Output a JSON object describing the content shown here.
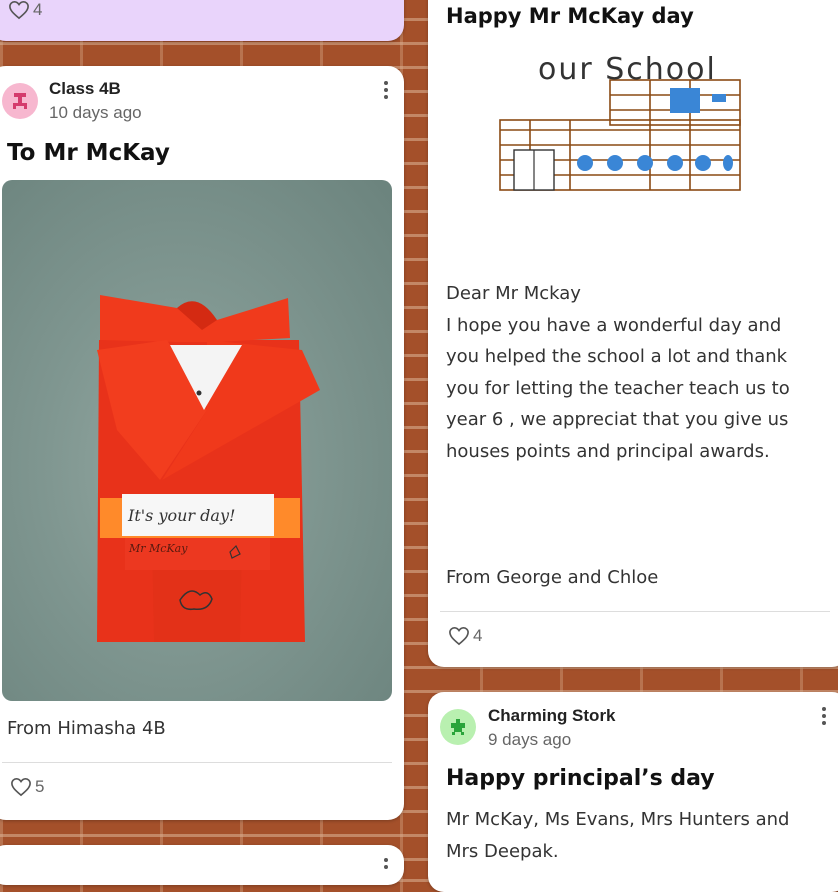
{
  "cards": [
    {
      "likes": "4"
    },
    {
      "author": "Class 4B",
      "time": "10 days ago",
      "title": "To Mr McKay",
      "image_note": {
        "line1": "It's your day!",
        "line2": "Mr McKay"
      },
      "caption": "From Himasha 4B",
      "likes": "5"
    },
    {
      "title": "Happy Mr McKay day",
      "drawing_label": "our School",
      "body_lines": [
        "Dear  Mr Mckay",
        "I hope you have a wonderful day and",
        "you helped the school a lot and thank",
        "you for letting the teacher teach us to",
        "year 6 , we appreciat that you give us",
        "houses points and principal awards."
      ],
      "signoff": "From George and Chloe",
      "likes": "4"
    },
    {
      "author": "Charming Stork",
      "time": "9 days ago",
      "title": "Happy principal’s day",
      "body_lines": [
        "Mr McKay, Ms Evans, Mrs Hunters and",
        "Mrs Deepak."
      ]
    }
  ],
  "colors": {
    "wall": "#a4502a",
    "purple_card": "#e9d4fb",
    "avatar_pink": "#f7b7cf",
    "avatar_green": "#b9f0b0",
    "paper_red": "#e8321a"
  }
}
